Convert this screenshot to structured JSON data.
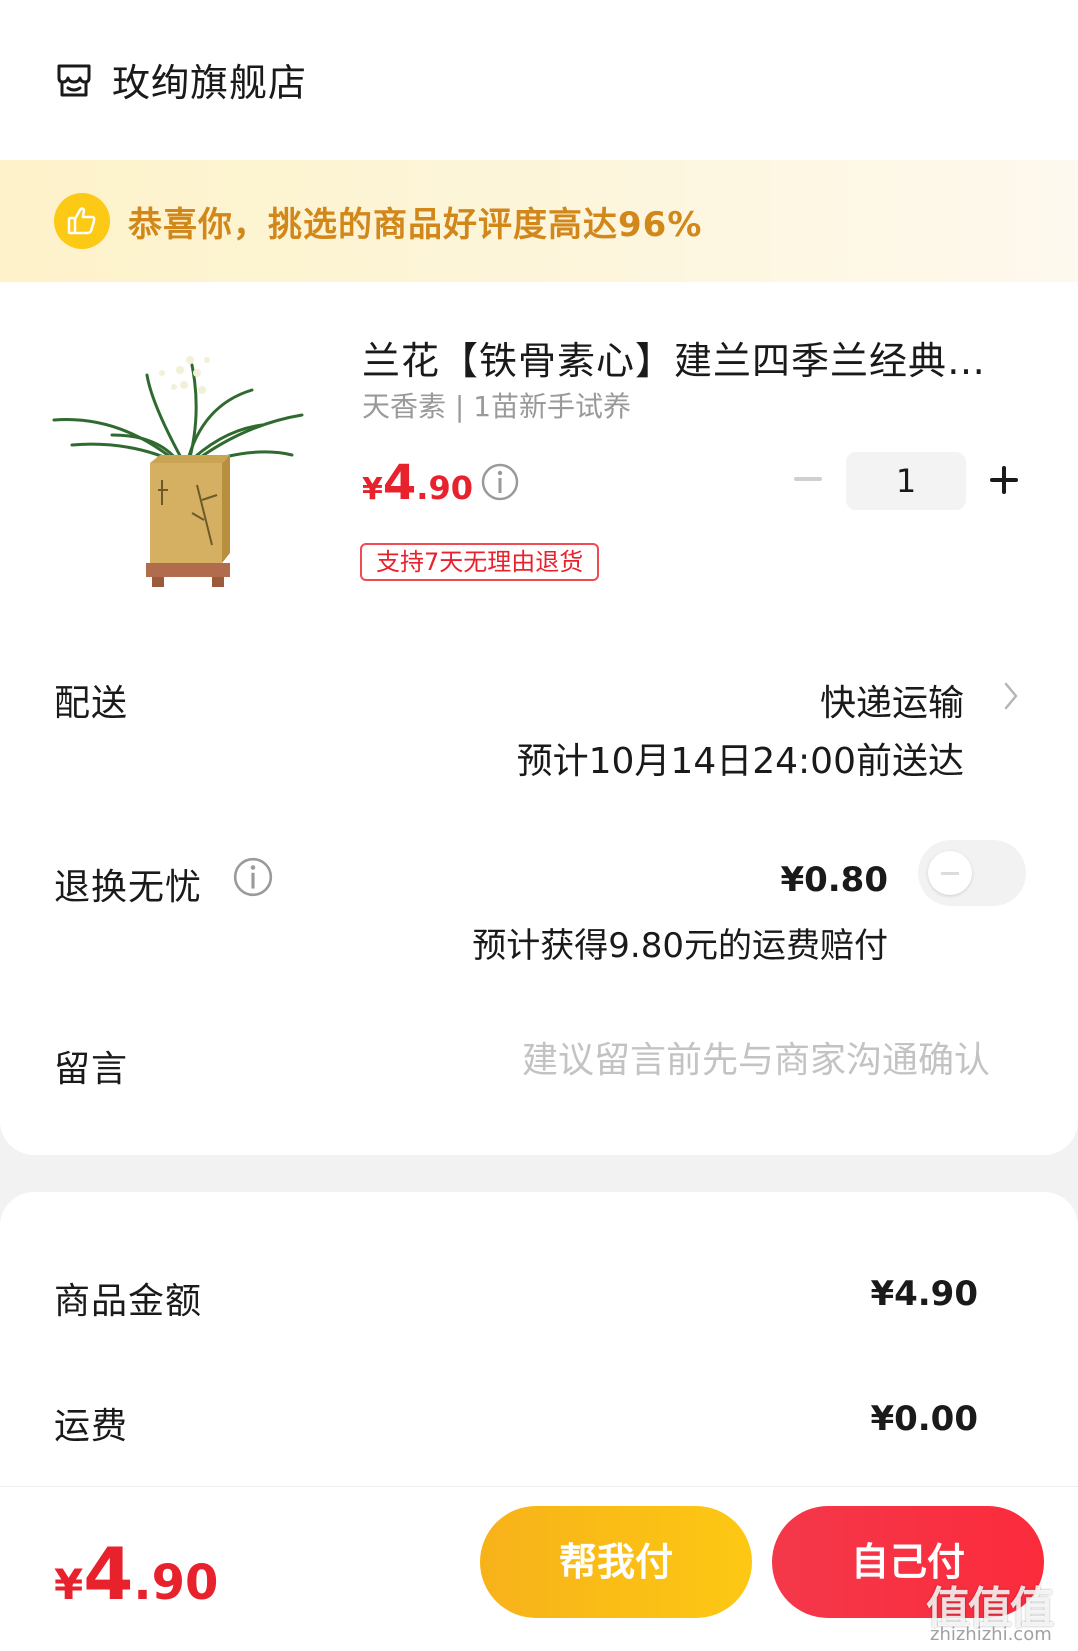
{
  "store": {
    "name": "玫绚旗舰店",
    "icon": "store-icon"
  },
  "banner": {
    "text": "恭喜你，挑选的商品好评度高达96%",
    "icon": "thumbs-up-icon"
  },
  "product": {
    "title": "兰花【铁骨素心】建兰四季兰经典素...",
    "spec": "天香素 | 1苗新手试养",
    "price": {
      "currency": "¥",
      "integer": "4",
      "decimal": ".90"
    },
    "quantity": "1",
    "return_badge": "支持7天无理由退货"
  },
  "delivery": {
    "label": "配送",
    "method": "快递运输",
    "eta": "预计10月14日24:00前送达"
  },
  "worry_free": {
    "label": "退换无忧",
    "price": "¥0.80",
    "desc": "预计获得9.80元的运费赔付",
    "enabled": false
  },
  "note": {
    "label": "留言",
    "placeholder": "建议留言前先与商家沟通确认"
  },
  "summary": {
    "goods_label": "商品金额",
    "goods_value": "¥4.90",
    "shipping_label": "运费",
    "shipping_value": "¥0.00"
  },
  "footer": {
    "total": {
      "currency": "¥",
      "integer": "4",
      "decimal": ".90"
    },
    "help_pay": "帮我付",
    "self_pay": "自己付"
  },
  "watermark": {
    "text": "值值值",
    "url": "zhizhizhi.com"
  },
  "colors": {
    "price_red": "#e8222d",
    "banner_text": "#d2871a",
    "help_btn": "#fdc813",
    "self_btn": "#fb2b3c"
  }
}
